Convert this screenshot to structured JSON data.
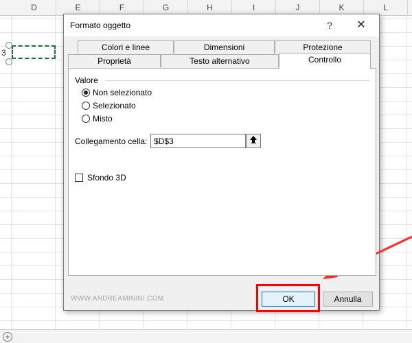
{
  "sheet": {
    "columns": [
      "D",
      "E",
      "F",
      "G",
      "H",
      "I",
      "J",
      "K",
      "L"
    ],
    "row_number": "3",
    "add_sheet_icon": "plus-circle-icon"
  },
  "dialog": {
    "title": "Formato oggetto",
    "help_label": "?",
    "close_label": "✕",
    "tabs_back": [
      "Colori e linee",
      "Dimensioni",
      "Protezione"
    ],
    "tabs_front": [
      "Proprietà",
      "Testo alternativo",
      "Controllo"
    ],
    "active_tab": "Controllo",
    "group_title": "Valore",
    "radios": [
      {
        "label": "Non selezionato",
        "checked": true
      },
      {
        "label": "Selezionato",
        "checked": false
      },
      {
        "label": "Misto",
        "checked": false
      }
    ],
    "link_label": "Collegamento cella:",
    "link_value": "$D$3",
    "collapse_icon": "up-arrow-icon",
    "checkbox_label": "Sfondo 3D",
    "checkbox_checked": false,
    "watermark": "WWW.ANDREAMININI.COM",
    "ok_label": "OK",
    "cancel_label": "Annulla"
  },
  "annotation": {
    "highlight_color": "#ff0000",
    "arrow_color": "#ff2a2a"
  }
}
